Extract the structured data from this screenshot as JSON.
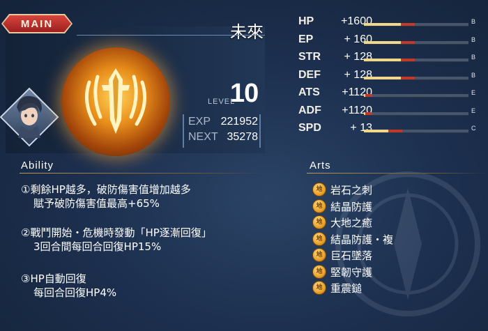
{
  "header": {
    "tab_label": "MAIN",
    "character_name": "未來"
  },
  "level": {
    "label": "LEVEL",
    "value": "10"
  },
  "exp": {
    "exp_label": "EXP",
    "exp_value": "221952",
    "next_label": "NEXT",
    "next_value": "35278"
  },
  "stats": [
    {
      "name": "HP",
      "value": "+1600",
      "fill": 0.42,
      "grade": "B"
    },
    {
      "name": "EP",
      "value": "+ 160",
      "fill": 0.42,
      "grade": "B"
    },
    {
      "name": "STR",
      "value": "+ 128",
      "fill": 0.42,
      "grade": "B"
    },
    {
      "name": "DEF",
      "value": "+ 128",
      "fill": 0.42,
      "grade": "B"
    },
    {
      "name": "ATS",
      "value": "+1120",
      "fill": 0.08,
      "grade": "E"
    },
    {
      "name": "ADF",
      "value": "+1120",
      "fill": 0.08,
      "grade": "E"
    },
    {
      "name": "SPD",
      "value": "+  13",
      "fill": 0.3,
      "grade": "C"
    }
  ],
  "ability": {
    "heading": "Ability",
    "items": [
      {
        "line1": "①剩餘HP越多，破防傷害值增加越多",
        "line2": "賦予破防傷害值最高+65%"
      },
      {
        "line1": "②戰鬥開始・危機時發動「HP逐漸回復」",
        "line2": "3回合間每回合回復HP15%"
      },
      {
        "line1": "③HP自動回復",
        "line2": "每回合回復HP4%"
      }
    ]
  },
  "arts": {
    "heading": "Arts",
    "icon_glyph": "地",
    "items": [
      "岩石之刺",
      "結晶防護",
      "大地之癒",
      "結晶防護・複",
      "巨石墜落",
      "堅韌守護",
      "重震鎚"
    ]
  },
  "colors": {
    "tab_red": "#c0392b",
    "bar_gold": "#f0d78e",
    "bar_red": "#c0392b",
    "orb_gold": "#e88d1a"
  }
}
